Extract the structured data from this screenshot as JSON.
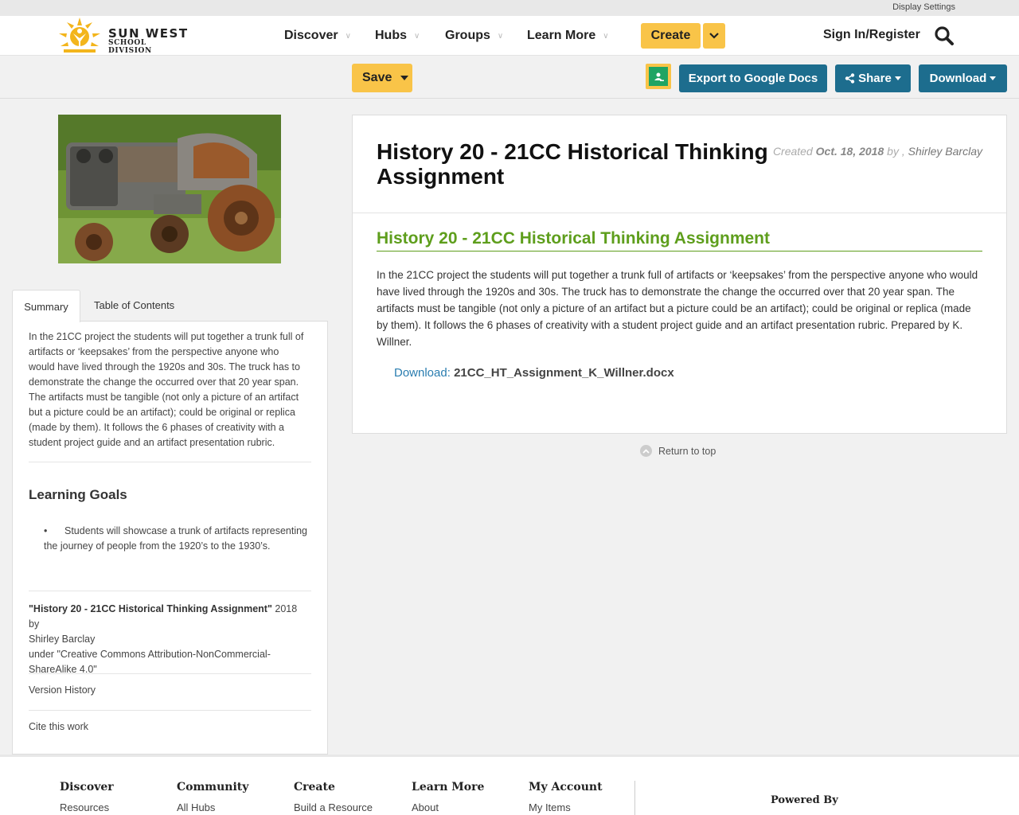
{
  "utility": {
    "display_settings": "Display Settings"
  },
  "header": {
    "logo": {
      "line1": "SUN WEST",
      "line2": "SCHOOL DIVISION"
    },
    "nav": [
      "Discover",
      "Hubs",
      "Groups",
      "Learn More"
    ],
    "create_label": "Create",
    "signin_label": "Sign In/Register"
  },
  "toolbar": {
    "save_label": "Save",
    "export_label": "Export to Google Docs",
    "share_label": "Share",
    "download_label": "Download"
  },
  "sidebar": {
    "tabs": [
      "Summary",
      "Table of Contents"
    ],
    "summary": "In the 21CC project the students will put together a trunk full of artifacts or ‘keepsakes’ from the perspective anyone who would have lived through the 1920s and 30s. The truck has to demonstrate the change the occurred over that 20 year span. The artifacts must be tangible (not only a picture of an artifact but a picture could be an artifact); could be original or replica (made by them). It follows the 6 phases of creativity with a student project guide and an artifact presentation rubric.",
    "learning_goals_title": "Learning Goals",
    "learning_goals": [
      "Students will showcase a trunk of artifacts representing the journey of people from the 1920’s to the 1930’s."
    ],
    "attribution": {
      "work": "\"History 20 - 21CC Historical Thinking Assignment\"",
      "year_by": "2018 by",
      "author": "Shirley Barclay",
      "license": "under \"Creative Commons Attribution-NonCommercial-ShareAlike 4.0\""
    },
    "version_history": "Version History",
    "cite": "Cite this work"
  },
  "resource": {
    "title": "History 20 - 21CC Historical Thinking Assignment",
    "created_prefix": "Created",
    "created_date": "Oct. 18, 2018",
    "by": "by ,",
    "author": "Shirley Barclay",
    "section_heading": "History 20 - 21CC Historical Thinking Assignment",
    "body": "In the 21CC project the students will put together a trunk full of artifacts or ‘keepsakes’ from the perspective anyone who would have lived through the 1920s and 30s.  The truck has to demonstrate the change the occurred over that 20 year span.  The artifacts must be tangible (not only a picture of an artifact but a picture could be an artifact); could be original or replica (made by them).  It follows the 6 phases of creativity with a student project guide and an artifact presentation rubric.  Prepared by K. Willner.",
    "download_label": "Download:",
    "download_file": "21CC_HT_Assignment_K_Willner.docx"
  },
  "return_to_top": "Return to top",
  "footer": {
    "columns": [
      {
        "heading": "Discover",
        "link": "Resources"
      },
      {
        "heading": "Community",
        "link": "All Hubs"
      },
      {
        "heading": "Create",
        "link": "Build a Resource"
      },
      {
        "heading": "Learn More",
        "link": "About"
      },
      {
        "heading": "My Account",
        "link": "My Items"
      }
    ],
    "powered_by": "Powered By"
  },
  "colors": {
    "accent_yellow": "#f9c448",
    "button_blue": "#1d6d8e",
    "link_green": "#5e9e1c"
  }
}
